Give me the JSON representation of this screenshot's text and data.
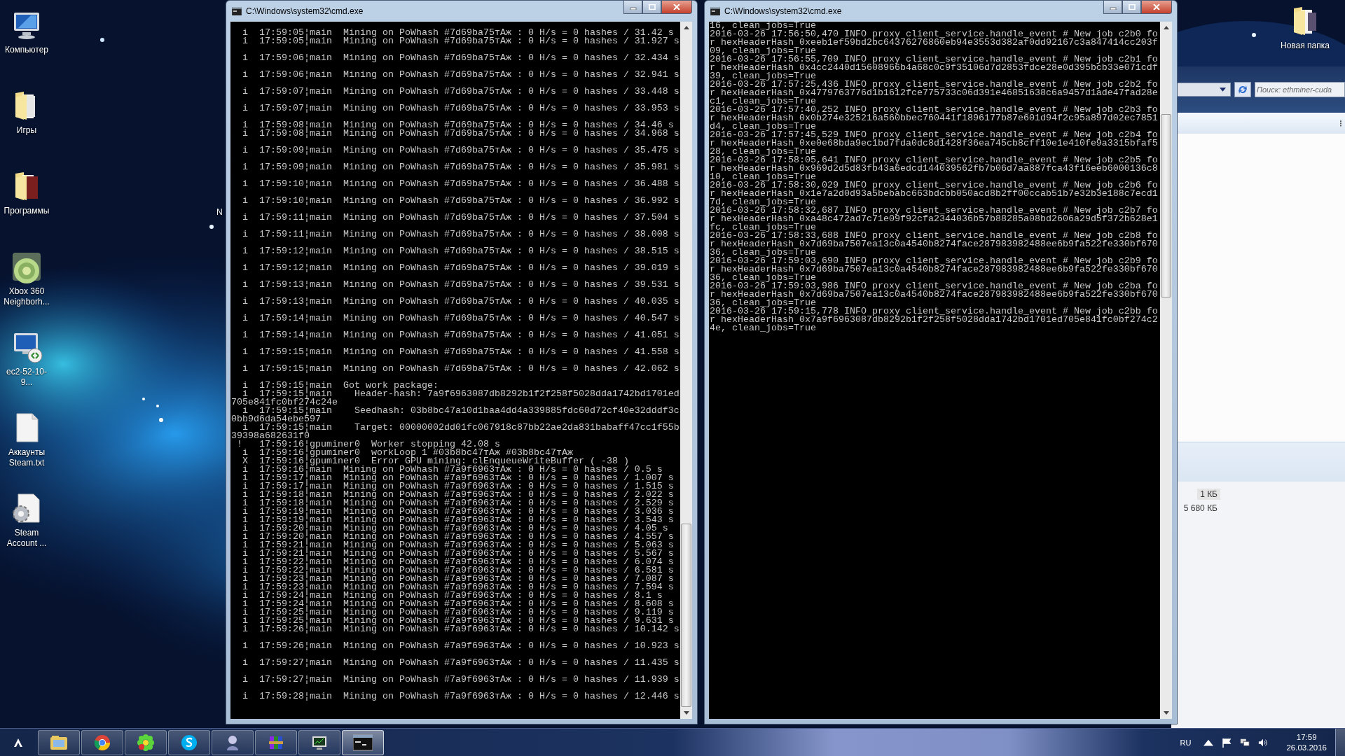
{
  "desktop_icons": [
    {
      "label": "Компьютер",
      "kind": "computer"
    },
    {
      "label": "Игры",
      "kind": "folder"
    },
    {
      "label": "Программы",
      "kind": "folder"
    },
    {
      "label": "Xbox 360 Neighborh...",
      "kind": "xbox"
    },
    {
      "label": "ec2-52-10-9...",
      "kind": "remote"
    },
    {
      "label": "Аккаунты Steam.txt",
      "kind": "document"
    },
    {
      "label": "Steam Account ...",
      "kind": "settings"
    }
  ],
  "partial_icon_label": "N",
  "corner_icon": {
    "label": "Новая папка"
  },
  "explorer": {
    "search": {
      "placeholder": "Поиск: ethminer-cuda"
    },
    "sizes": [
      "1 КБ",
      "5 680 КБ"
    ]
  },
  "windows": [
    {
      "title": "C:\\Windows\\system32\\cmd.exe",
      "lines": [
        "  i  17:59:05¦main  Mining on PoWhash #7d69ba75тАж : 0 H/s = 0 hashes / 31.42 s",
        "  i  17:59:05¦main  Mining on PoWhash #7d69ba75тАж : 0 H/s = 0 hashes / 31.927 s",
        "  i  17:59:06¦main  Mining on PoWhash #7d69ba75тАж : 0 H/s = 0 hashes / 32.434 s",
        "  i  17:59:06¦main  Mining on PoWhash #7d69ba75тАж : 0 H/s = 0 hashes / 32.941 s",
        "  i  17:59:07¦main  Mining on PoWhash #7d69ba75тАж : 0 H/s = 0 hashes / 33.448 s",
        "  i  17:59:07¦main  Mining on PoWhash #7d69ba75тАж : 0 H/s = 0 hashes / 33.953 s",
        "  i  17:59:08¦main  Mining on PoWhash #7d69ba75тАж : 0 H/s = 0 hashes / 34.46 s",
        "  i  17:59:08¦main  Mining on PoWhash #7d69ba75тАж : 0 H/s = 0 hashes / 34.968 s",
        "  i  17:59:09¦main  Mining on PoWhash #7d69ba75тАж : 0 H/s = 0 hashes / 35.475 s",
        "  i  17:59:09¦main  Mining on PoWhash #7d69ba75тАж : 0 H/s = 0 hashes / 35.981 s",
        "  i  17:59:10¦main  Mining on PoWhash #7d69ba75тАж : 0 H/s = 0 hashes / 36.488 s",
        "  i  17:59:10¦main  Mining on PoWhash #7d69ba75тАж : 0 H/s = 0 hashes / 36.992 s",
        "  i  17:59:11¦main  Mining on PoWhash #7d69ba75тАж : 0 H/s = 0 hashes / 37.504 s",
        "  i  17:59:11¦main  Mining on PoWhash #7d69ba75тАж : 0 H/s = 0 hashes / 38.008 s",
        "  i  17:59:12¦main  Mining on PoWhash #7d69ba75тАж : 0 H/s = 0 hashes / 38.515 s",
        "  i  17:59:12¦main  Mining on PoWhash #7d69ba75тАж : 0 H/s = 0 hashes / 39.019 s",
        "  i  17:59:13¦main  Mining on PoWhash #7d69ba75тАж : 0 H/s = 0 hashes / 39.531 s",
        "  i  17:59:13¦main  Mining on PoWhash #7d69ba75тАж : 0 H/s = 0 hashes / 40.035 s",
        "  i  17:59:14¦main  Mining on PoWhash #7d69ba75тАж : 0 H/s = 0 hashes / 40.547 s",
        "  i  17:59:14¦main  Mining on PoWhash #7d69ba75тАж : 0 H/s = 0 hashes / 41.051 s",
        "  i  17:59:15¦main  Mining on PoWhash #7d69ba75тАж : 0 H/s = 0 hashes / 41.558 s",
        "  i  17:59:15¦main  Mining on PoWhash #7d69ba75тАж : 0 H/s = 0 hashes / 42.062 s",
        "  i  17:59:15¦main  Got work package:",
        "  i  17:59:15¦main    Header-hash: 7a9f6963087db8292b1f2f258f5028dda1742bd1701ed705e841fc0bf274c24e",
        "  i  17:59:15¦main    Seedhash: 03b8bc47a10d1baa4dd4a339885fdc60d72cf40e32dddf3c0bb9d6da54ebe597",
        "  i  17:59:15¦main    Target: 00000002dd01fc067918c87bb22ae2da831babaff47cc1f55b39398a682631f0",
        " !   17:59:16¦gpuminer0  Worker stopping 42.08 s",
        "  i  17:59:16¦gpuminer0  workLoop 1 #03b8bc47тАж #03b8bc47тАж",
        "  X  17:59:16¦gpuminer0  Error GPU mining: clEnqueueWriteBuffer ( -38 )",
        "  i  17:59:16¦main  Mining on PoWhash #7a9f6963тАж : 0 H/s = 0 hashes / 0.5 s",
        "  i  17:59:17¦main  Mining on PoWhash #7a9f6963тАж : 0 H/s = 0 hashes / 1.007 s",
        "  i  17:59:17¦main  Mining on PoWhash #7a9f6963тАж : 0 H/s = 0 hashes / 1.515 s",
        "  i  17:59:18¦main  Mining on PoWhash #7a9f6963тАж : 0 H/s = 0 hashes / 2.022 s",
        "  i  17:59:18¦main  Mining on PoWhash #7a9f6963тАж : 0 H/s = 0 hashes / 2.529 s",
        "  i  17:59:19¦main  Mining on PoWhash #7a9f6963тАж : 0 H/s = 0 hashes / 3.036 s",
        "  i  17:59:19¦main  Mining on PoWhash #7a9f6963тАж : 0 H/s = 0 hashes / 3.543 s",
        "  i  17:59:20¦main  Mining on PoWhash #7a9f6963тАж : 0 H/s = 0 hashes / 4.05 s",
        "  i  17:59:20¦main  Mining on PoWhash #7a9f6963тАж : 0 H/s = 0 hashes / 4.557 s",
        "  i  17:59:21¦main  Mining on PoWhash #7a9f6963тАж : 0 H/s = 0 hashes / 5.063 s",
        "  i  17:59:21¦main  Mining on PoWhash #7a9f6963тАж : 0 H/s = 0 hashes / 5.567 s",
        "  i  17:59:22¦main  Mining on PoWhash #7a9f6963тАж : 0 H/s = 0 hashes / 6.074 s",
        "  i  17:59:22¦main  Mining on PoWhash #7a9f6963тАж : 0 H/s = 0 hashes / 6.581 s",
        "  i  17:59:23¦main  Mining on PoWhash #7a9f6963тАж : 0 H/s = 0 hashes / 7.087 s",
        "  i  17:59:23¦main  Mining on PoWhash #7a9f6963тАж : 0 H/s = 0 hashes / 7.594 s",
        "  i  17:59:24¦main  Mining on PoWhash #7a9f6963тАж : 0 H/s = 0 hashes / 8.1 s",
        "  i  17:59:24¦main  Mining on PoWhash #7a9f6963тАж : 0 H/s = 0 hashes / 8.608 s",
        "  i  17:59:25¦main  Mining on PoWhash #7a9f6963тАж : 0 H/s = 0 hashes / 9.119 s",
        "  i  17:59:25¦main  Mining on PoWhash #7a9f6963тАж : 0 H/s = 0 hashes / 9.631 s",
        "  i  17:59:26¦main  Mining on PoWhash #7a9f6963тАж : 0 H/s = 0 hashes / 10.142 s",
        "  i  17:59:26¦main  Mining on PoWhash #7a9f6963тАж : 0 H/s = 0 hashes / 10.923 s",
        "  i  17:59:27¦main  Mining on PoWhash #7a9f6963тАж : 0 H/s = 0 hashes / 11.435 s",
        "  i  17:59:27¦main  Mining on PoWhash #7a9f6963тАж : 0 H/s = 0 hashes / 11.939 s",
        "  i  17:59:28¦main  Mining on PoWhash #7a9f6963тАж : 0 H/s = 0 hashes / 12.446 s"
      ]
    },
    {
      "title": "C:\\Windows\\system32\\cmd.exe",
      "lines": [
        "16, clean_jobs=True",
        "2016-03-26 17:56:50,470 INFO proxy client_service.handle_event # New job c2b0 for hexHeaderHash 0xeeb1ef59bd2bc64376276860eb94e3553d382af0dd92167c3a847414cc203f09, clean_jobs=True",
        "2016-03-26 17:56:55,709 INFO proxy client_service.handle_event # New job c2b1 for hexHeaderHash 0x4cc2440d15608966b4a68c0c9f35106d7d2853fdce28e0d395bcb33e071cdf39, clean_jobs=True",
        "2016-03-26 17:57:25,436 INFO proxy client_service.handle_event # New job c2b2 for hexHeaderHash 0x4779763776d1b1612fce775733c06d391e46851638c6a9457d1ade47fad28ec1, clean_jobs=True",
        "2016-03-26 17:57:40,252 INFO proxy client_service.handle_event # New job c2b3 for hexHeaderHash 0x0b274e325216a560bbec760441f1896177b87e601d94f2c95a897d02ec7851d4, clean_jobs=True",
        "2016-03-26 17:57:45,529 INFO proxy client_service.handle_event # New job c2b4 for hexHeaderHash 0xe0e68bda9ec1bd7fda0dc8d1428f36ea745cb8cff10e1e410fe9a3315bfaf528, clean_jobs=True",
        "2016-03-26 17:58:05,641 INFO proxy client_service.handle_event # New job c2b5 for hexHeaderHash 0x969d2d5d83fb43a6edcd144039562fb7b06d7aa887fca43f16eeb6000136c810, clean_jobs=True",
        "2016-03-26 17:58:30,029 INFO proxy client_service.handle_event # New job c2b6 for hexHeaderHash 0x1e7a2d0d93a5bebabc663bdcbb050acd8b2ff00ccab51b7e32b3e188c7ecd17d, clean_jobs=True",
        "2016-03-26 17:58:32,687 INFO proxy client_service.handle_event # New job c2b7 for hexHeaderHash 0xa48c472ad7c71e09f92cfa2344036b57b88285a08bd2606a29d5f372b628e1fc, clean_jobs=True",
        "2016-03-26 17:58:33,688 INFO proxy client_service.handle_event # New job c2b8 for hexHeaderHash 0x7d69ba7507ea13c0a4540b8274face287983982488ee6b9fa522fe330bf67036, clean_jobs=True",
        "2016-03-26 17:59:03,690 INFO proxy client_service.handle_event # New job c2b9 for hexHeaderHash 0x7d69ba7507ea13c0a4540b8274face287983982488ee6b9fa522fe330bf67036, clean_jobs=True",
        "2016-03-26 17:59:03,986 INFO proxy client_service.handle_event # New job c2ba for hexHeaderHash 0x7d69ba7507ea13c0a4540b8274face287983982488ee6b9fa522fe330bf67036, clean_jobs=True",
        "2016-03-26 17:59:15,778 INFO proxy client_service.handle_event # New job c2bb for hexHeaderHash 0x7a9f6963087db8292b1f2f258f5028dda1742bd1701ed705e841fc0bf274c24e, clean_jobs=True"
      ]
    }
  ],
  "taskbar": {
    "apps": [
      {
        "kind": "explorer",
        "selected": false
      },
      {
        "kind": "chrome",
        "selected": false
      },
      {
        "kind": "icq",
        "selected": false
      },
      {
        "kind": "skype",
        "selected": false
      },
      {
        "kind": "figure",
        "selected": false
      },
      {
        "kind": "archive",
        "selected": false
      },
      {
        "kind": "monitor",
        "selected": false
      },
      {
        "kind": "console",
        "selected": true
      }
    ],
    "language": "RU",
    "time": "17:59",
    "date": "26.03.2016"
  }
}
